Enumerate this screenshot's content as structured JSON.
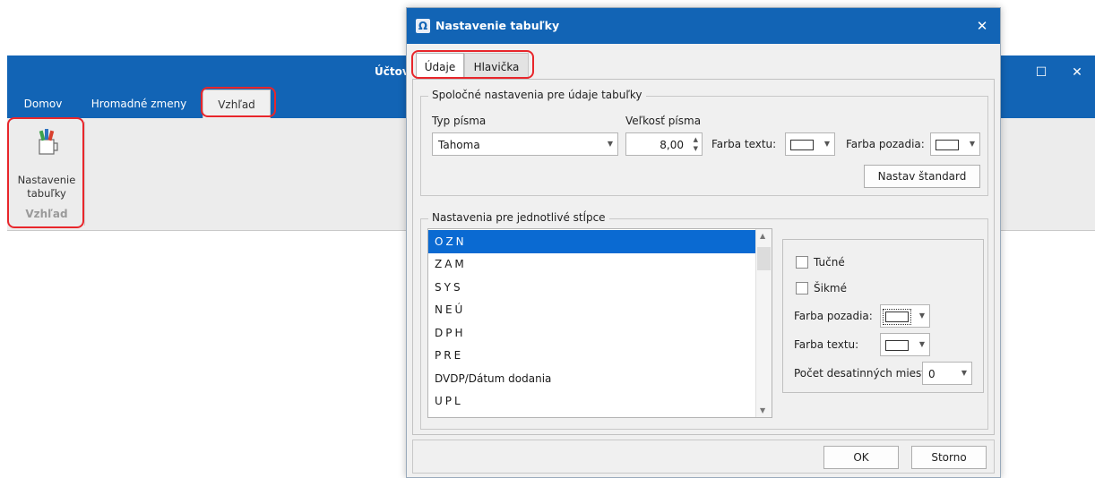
{
  "app": {
    "title": "Účtov",
    "ribbon_tabs": [
      "Domov",
      "Hromadné zmeny",
      "Vzhľad"
    ],
    "ribbon_button_label_line1": "Nastavenie",
    "ribbon_button_label_line2": "tabuľky",
    "ribbon_group_label": "Vzhľad",
    "maximize_glyph": "☐",
    "close_glyph": "✕"
  },
  "dialog": {
    "icon_glyph": "Ω",
    "title": "Nastavenie tabuľky",
    "close_glyph": "✕",
    "tabs": [
      "Údaje",
      "Hlavička"
    ],
    "common_group": {
      "legend": "Spoločné nastavenia pre údaje tabuľky",
      "font_label": "Typ písma",
      "font_value": "Tahoma",
      "size_label": "Veľkosť písma",
      "size_value": "8,00",
      "text_color_label": "Farba textu:",
      "bg_color_label": "Farba pozadia:",
      "standard_button": "Nastav štandard"
    },
    "column_group": {
      "legend": "Nastavenia pre jednotlivé stĺpce",
      "columns": [
        "OZN",
        "ZAM",
        "SYS",
        "NEÚ",
        "DPH",
        "PRE",
        "DVDP/Dátum dodania",
        "UPL"
      ],
      "selected_index": 0,
      "bold_label": "Tučné",
      "italic_label": "Šikmé",
      "bg_color_label": "Farba pozadia:",
      "text_color_label": "Farba textu:",
      "decimals_label": "Počet desatinných miest:",
      "decimals_value": "0"
    },
    "ok_button": "OK",
    "cancel_button": "Storno"
  },
  "colors": {
    "titlebar": "#1264b5",
    "selection": "#0a6ad2",
    "highlight": "#e8262b"
  }
}
